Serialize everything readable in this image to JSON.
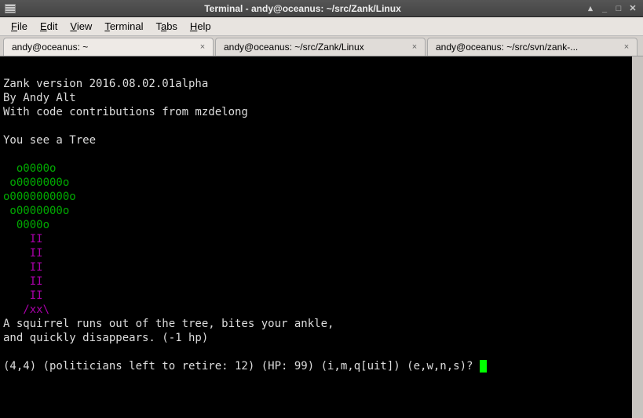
{
  "window": {
    "title": "Terminal - andy@oceanus: ~/src/Zank/Linux"
  },
  "menu": {
    "items": [
      {
        "label": "File",
        "ul": "F"
      },
      {
        "label": "Edit",
        "ul": "E"
      },
      {
        "label": "View",
        "ul": "V"
      },
      {
        "label": "Terminal",
        "ul": "T"
      },
      {
        "label": "Tabs",
        "ul": "a"
      },
      {
        "label": "Help",
        "ul": "H"
      }
    ]
  },
  "tabs": [
    {
      "label": "andy@oceanus: ~",
      "active": true
    },
    {
      "label": "andy@oceanus: ~/src/Zank/Linux",
      "active": false
    },
    {
      "label": "andy@oceanus: ~/src/svn/zank-...",
      "active": false
    }
  ],
  "terminal": {
    "header": [
      "Zank version 2016.08.02.01alpha",
      "By Andy Alt",
      "With code contributions from mzdelong"
    ],
    "scene_intro": "You see a Tree",
    "tree_foliage": [
      "  o0000o",
      " o0000000o",
      "o000000000o",
      " o0000000o",
      "  0000o"
    ],
    "tree_trunk": [
      "    II",
      "    II",
      "    II",
      "    II",
      "    II",
      "   /xx\\"
    ],
    "event": [
      "A squirrel runs out of the tree, bites your ankle,",
      "and quickly disappears. (-1 hp)"
    ],
    "status": "(4,4) (politicians left to retire: 12) (HP: 99) (i,m,q[uit]) (e,w,n,s)? "
  }
}
